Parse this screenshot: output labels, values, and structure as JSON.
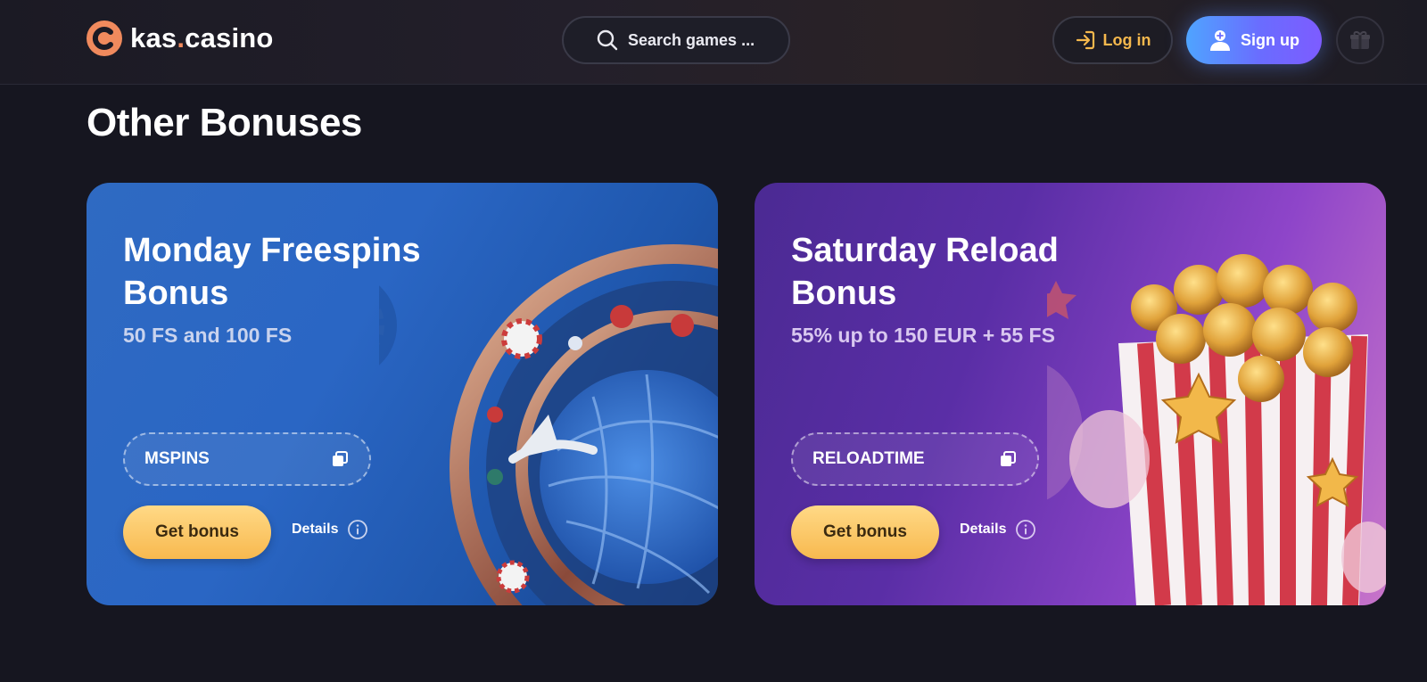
{
  "header": {
    "logo_main": "kas",
    "logo_dot": ".",
    "logo_tail": "casino",
    "search_placeholder": "Search games ...",
    "login_label": "Log in",
    "signup_label": "Sign up",
    "icons": [
      "search-icon",
      "login-icon",
      "user-add-icon",
      "gift-icon"
    ]
  },
  "section": {
    "title": "Other Bonuses"
  },
  "cards": [
    {
      "title": "Monday Freespins Bonus",
      "subtitle": "50 FS and 100 FS",
      "code": "MSPINS",
      "button_label": "Get bonus",
      "details_label": "Details"
    },
    {
      "title": "Saturday Reload Bonus",
      "subtitle": "55% up to 150 EUR + 55 FS",
      "code": "RELOADTIME",
      "button_label": "Get bonus",
      "details_label": "Details"
    }
  ],
  "colors": {
    "background": "#161620",
    "accent_orange": "#f08a5d",
    "login_text": "#f5b84d",
    "signup_gradient_start": "#4fa4ff",
    "signup_gradient_end": "#7d5cff",
    "get_bonus_start": "#ffd986",
    "get_bonus_end": "#f8b94f",
    "card1_bg": "#2a66c4",
    "card2_bg": "#5a2ea6"
  }
}
